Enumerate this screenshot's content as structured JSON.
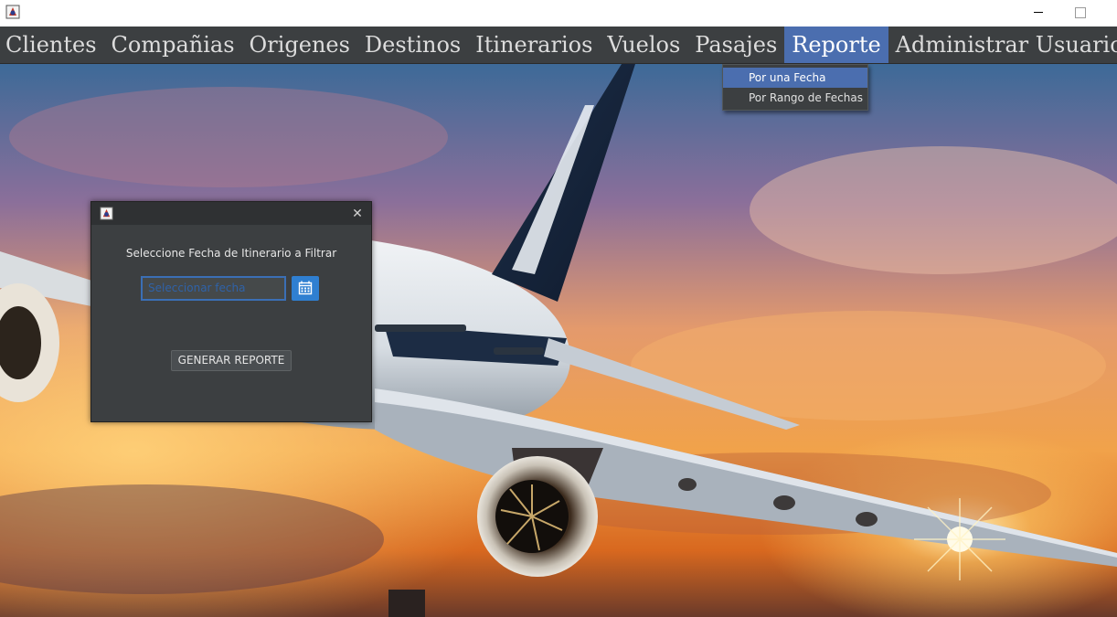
{
  "window": {
    "icon": "java-app-icon",
    "controls": [
      "minimize-icon",
      "maximize-icon"
    ]
  },
  "menubar": {
    "items": [
      {
        "label": "Clientes"
      },
      {
        "label": "Compañias"
      },
      {
        "label": "Origenes"
      },
      {
        "label": "Destinos"
      },
      {
        "label": "Itinerarios"
      },
      {
        "label": "Vuelos"
      },
      {
        "label": "Pasajes"
      },
      {
        "label": "Reporte",
        "active": true
      },
      {
        "label": "Administrar Usuarios"
      }
    ]
  },
  "reporte_menu": {
    "items": [
      {
        "label": "Por una Fecha",
        "selected": true
      },
      {
        "label": "Por Rango de Fechas"
      }
    ]
  },
  "dialog": {
    "icon": "java-app-icon",
    "close_icon": "close-icon",
    "label": "Seleccione Fecha de Itinerario a Filtrar",
    "date_placeholder": "Seleccionar fecha",
    "calendar_icon": "calendar-icon",
    "generate_button": "GENERAR REPORTE"
  },
  "colors": {
    "menubar_bg": "#3c3f41",
    "accent": "#4b6eaf",
    "calendar_button": "#2f7fd1"
  }
}
